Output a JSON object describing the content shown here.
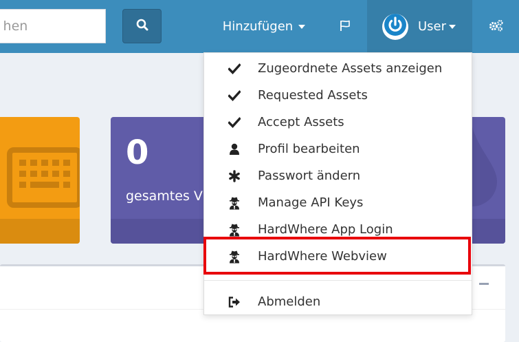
{
  "search": {
    "placeholder": "Suchen"
  },
  "navbar": {
    "add_label": "Hinzufügen",
    "user_label": "User"
  },
  "tiles": [
    {
      "color": "#f39c12",
      "icon": "keyboard-icon"
    },
    {
      "color": "#605ca8",
      "number": "0",
      "text": "gesamtes V",
      "icon": "droplet-icon"
    }
  ],
  "user_menu": {
    "items": [
      {
        "label": "Zugeordnete Assets anzeigen",
        "icon": "check-icon"
      },
      {
        "label": "Requested Assets",
        "icon": "check-icon"
      },
      {
        "label": "Accept Assets",
        "icon": "check-icon"
      },
      {
        "label": "Profil bearbeiten",
        "icon": "user-icon"
      },
      {
        "label": "Passwort ändern",
        "icon": "asterisk-icon"
      },
      {
        "label": "Manage API Keys",
        "icon": "user-secret-icon"
      },
      {
        "label": "HardWhere App Login",
        "icon": "user-secret-icon"
      },
      {
        "label": "HardWhere Webview",
        "icon": "user-secret-icon",
        "highlighted": true
      }
    ],
    "logout": {
      "label": "Abmelden",
      "icon": "sign-out-icon"
    }
  },
  "colors": {
    "navbar": "#3c8dbc",
    "navbar_active": "#367fa9",
    "highlight_border": "#e8000b",
    "background": "#ecf0f5"
  }
}
